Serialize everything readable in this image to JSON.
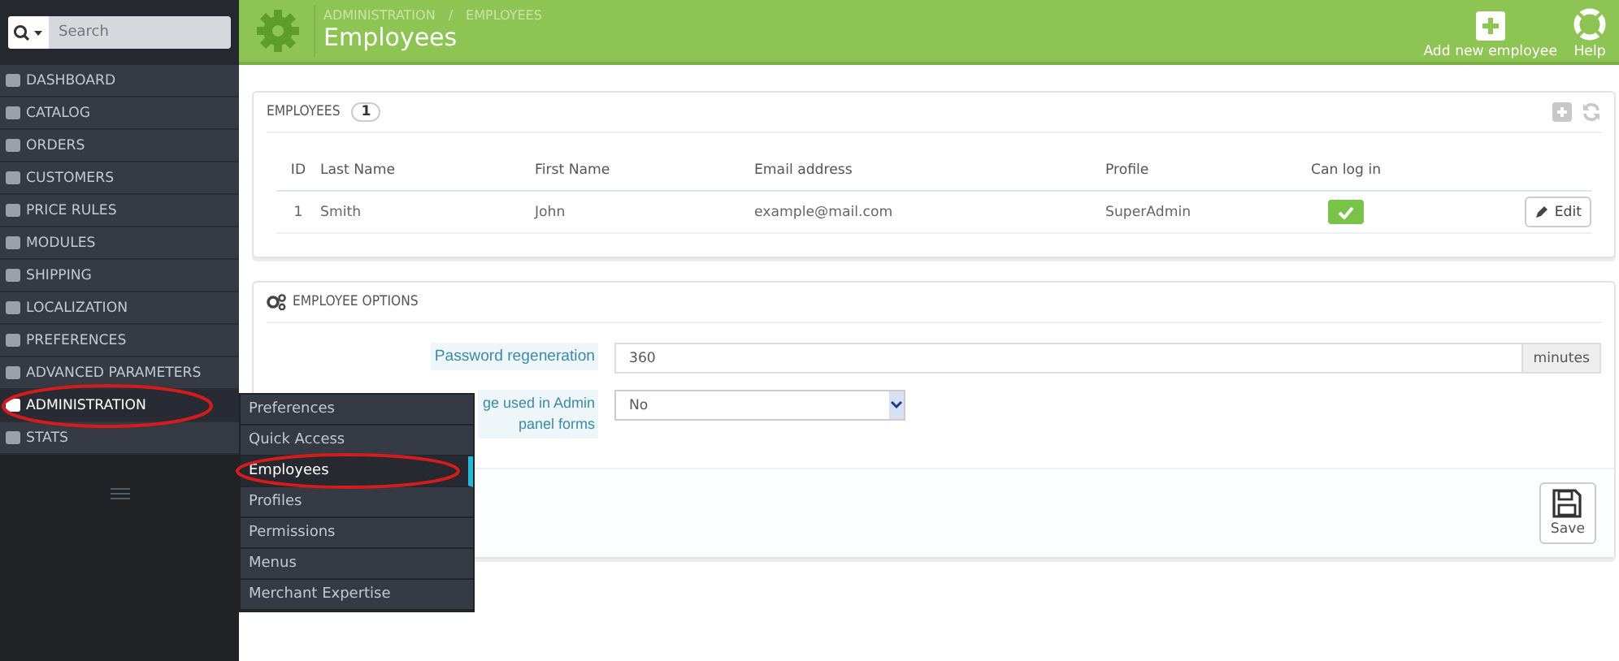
{
  "search": {
    "placeholder": "Search"
  },
  "sidebar": {
    "items": [
      {
        "label": "DASHBOARD",
        "selected": false
      },
      {
        "label": "CATALOG",
        "selected": false
      },
      {
        "label": "ORDERS",
        "selected": false
      },
      {
        "label": "CUSTOMERS",
        "selected": false
      },
      {
        "label": "PRICE RULES",
        "selected": false
      },
      {
        "label": "MODULES",
        "selected": false
      },
      {
        "label": "SHIPPING",
        "selected": false
      },
      {
        "label": "LOCALIZATION",
        "selected": false
      },
      {
        "label": "PREFERENCES",
        "selected": false
      },
      {
        "label": "ADVANCED PARAMETERS",
        "selected": false
      },
      {
        "label": "ADMINISTRATION",
        "selected": true,
        "annotated": true
      },
      {
        "label": "STATS",
        "selected": false
      }
    ]
  },
  "submenu": {
    "items": [
      {
        "label": "Preferences",
        "selected": false
      },
      {
        "label": "Quick Access",
        "selected": false
      },
      {
        "label": "Employees",
        "selected": true,
        "annotated": true
      },
      {
        "label": "Profiles",
        "selected": false
      },
      {
        "label": "Permissions",
        "selected": false
      },
      {
        "label": "Menus",
        "selected": false
      },
      {
        "label": "Merchant Expertise",
        "selected": false
      }
    ]
  },
  "header": {
    "breadcrumb": [
      "ADMINISTRATION",
      "EMPLOYEES"
    ],
    "breadcrumb_separator": "/",
    "title": "Employees",
    "actions": [
      {
        "kind": "add",
        "label": "Add new employee"
      },
      {
        "kind": "help",
        "label": "Help"
      }
    ]
  },
  "employees_panel": {
    "title": "EMPLOYEES",
    "count": "1",
    "table": {
      "columns": [
        "ID",
        "Last Name",
        "First Name",
        "Email address",
        "Profile",
        "Can log in"
      ],
      "rows": [
        {
          "id": "1",
          "last_name": "Smith",
          "first_name": "John",
          "email": "example@mail.com",
          "profile": "SuperAdmin",
          "can_log_in": true,
          "action": "Edit"
        }
      ]
    }
  },
  "options_panel": {
    "title": "EMPLOYEE OPTIONS",
    "fields": [
      {
        "kind": "text",
        "label": "Password regeneration",
        "value": "360",
        "suffix": "minutes"
      },
      {
        "kind": "select",
        "label": "ge used in Admin panel forms",
        "value": "No"
      }
    ],
    "save": "Save"
  }
}
